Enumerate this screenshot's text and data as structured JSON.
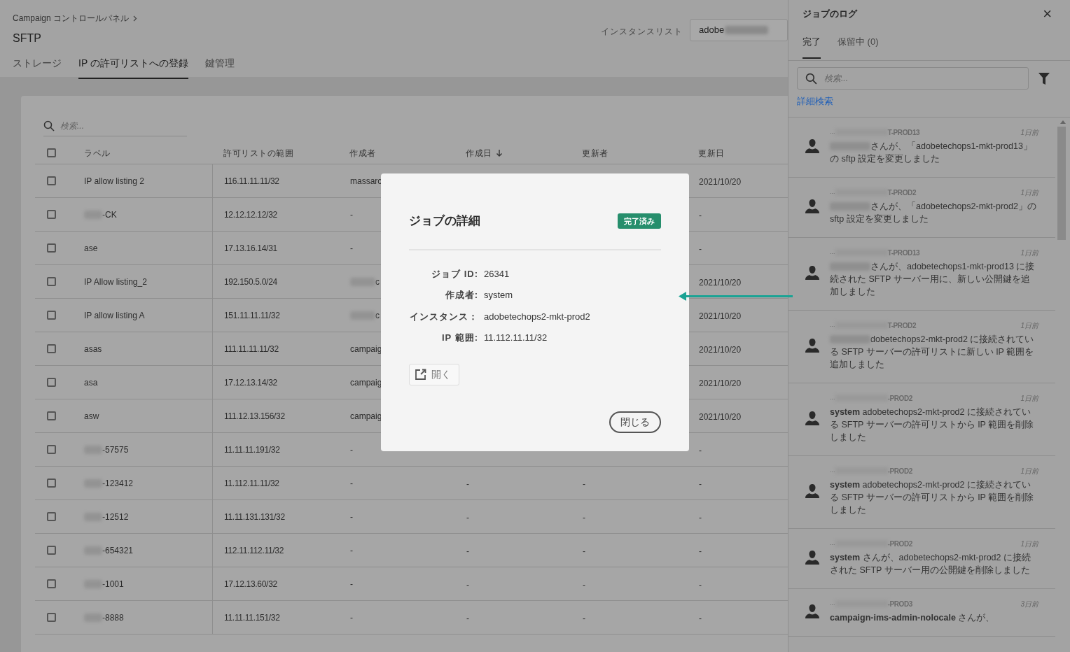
{
  "breadcrumb": {
    "text": "Campaign コントロールパネル"
  },
  "page_title": "SFTP",
  "tabs": [
    {
      "label": "ストレージ",
      "selected": false
    },
    {
      "label": "IP の許可リストへの登録",
      "selected": true
    },
    {
      "label": "鍵管理",
      "selected": false
    }
  ],
  "instance_list": {
    "label": "インスタンスリスト",
    "value": "adobe",
    "redacted": true
  },
  "table": {
    "search_placeholder": "検索...",
    "select_all_checked": false,
    "columns": [
      {
        "label": "ラベル"
      },
      {
        "label": "許可リストの範囲"
      },
      {
        "label": "作成者"
      },
      {
        "label": "作成日",
        "sorted": true
      },
      {
        "label": "更新者"
      },
      {
        "label": "更新日"
      }
    ],
    "rows": [
      {
        "checked": false,
        "label": "IP allow listing 2",
        "label_redacted": false,
        "range": "116.11.11.11/32",
        "creator": "massarc",
        "creator_redacted": false,
        "updated": "2021/10/20"
      },
      {
        "checked": false,
        "label": "-CK",
        "label_redacted": true,
        "range": "12.12.12.12/32",
        "creator": "-",
        "creator_redacted": false,
        "updated": "-"
      },
      {
        "checked": false,
        "label": "ase",
        "label_redacted": false,
        "range": "17.13.16.14/31",
        "creator": "-",
        "creator_redacted": false,
        "updated": "-"
      },
      {
        "checked": false,
        "label": "IP Allow listing_2",
        "label_redacted": false,
        "range": "192.150.5.0/24",
        "creator": "c",
        "creator_redacted": true,
        "updated": "2021/10/20"
      },
      {
        "checked": false,
        "label": "IP allow listing A",
        "label_redacted": false,
        "range": "151.11.11.11/32",
        "creator": "c",
        "creator_redacted": true,
        "updated": "2021/10/20"
      },
      {
        "checked": false,
        "label": "asas",
        "label_redacted": false,
        "range": "111.11.11.11/32",
        "creator": "campaig",
        "creator_redacted": false,
        "updated": "2021/10/20"
      },
      {
        "checked": false,
        "label": "asa",
        "label_redacted": false,
        "range": "17.12.13.14/32",
        "creator": "campaig",
        "creator_redacted": false,
        "updated": "2021/10/20"
      },
      {
        "checked": false,
        "label": "asw",
        "label_redacted": false,
        "range": "111.12.13.156/32",
        "creator": "campaig",
        "creator_redacted": false,
        "updated": "2021/10/20"
      },
      {
        "checked": false,
        "label": "-57575",
        "label_redacted": true,
        "range": "11.11.11.191/32",
        "creator": "-",
        "creator_redacted": false,
        "updated": "-"
      },
      {
        "checked": false,
        "label": "-123412",
        "label_redacted": true,
        "range": "11.112.11.11/32",
        "creator": "-",
        "creator_redacted": false,
        "created": "-",
        "updater": "-",
        "updated": "-"
      },
      {
        "checked": false,
        "label": "-12512",
        "label_redacted": true,
        "range": "11.11.131.131/32",
        "creator": "-",
        "creator_redacted": false,
        "created": "-",
        "updater": "-",
        "updated": "-"
      },
      {
        "checked": false,
        "label": "-654321",
        "label_redacted": true,
        "range": "112.11.112.11/32",
        "creator": "-",
        "creator_redacted": false,
        "created": "-",
        "updater": "-",
        "updated": "-"
      },
      {
        "checked": false,
        "label": "-1001",
        "label_redacted": true,
        "range": "17.12.13.60/32",
        "creator": "-",
        "creator_redacted": false,
        "created": "-",
        "updater": "-",
        "updated": "-"
      },
      {
        "checked": false,
        "label": "-8888",
        "label_redacted": true,
        "range": "11.11.11.151/32",
        "creator": "-",
        "creator_redacted": false,
        "created": "-",
        "updater": "-",
        "updated": "-"
      }
    ]
  },
  "job_log": {
    "title": "ジョブのログ",
    "close": "×",
    "tabs": [
      {
        "label": "完了",
        "selected": true
      },
      {
        "label": "保留中 (0)",
        "selected": false
      }
    ],
    "search_placeholder": "検索...",
    "advanced_search": "詳細検索",
    "items": [
      {
        "prefix": "...",
        "source": "T-PROD13",
        "time": "1日前",
        "user_redacted": true,
        "message": "さんが、「adobetechops1-mkt-prod13」の sftp 設定を変更しました"
      },
      {
        "prefix": "...",
        "source": "T-PROD2",
        "time": "1日前",
        "user_redacted": true,
        "message": "さんが、「adobetechops2-mkt-prod2」の sftp 設定を変更しました"
      },
      {
        "prefix": "...",
        "source": "T-PROD13",
        "time": "1日前",
        "user_redacted": true,
        "message": "さんが、adobetechops1-mkt-prod13 に接続された SFTP サーバー用に、新しい公開鍵を追加しました"
      },
      {
        "prefix": "...",
        "source": "T-PROD2",
        "time": "1日前",
        "user_redacted": true,
        "message": "dobetechops2-mkt-prod2 に接続されている SFTP サーバーの許可リストに新しい IP 範囲を追加しました"
      },
      {
        "prefix": "...",
        "source": "-PROD2",
        "time": "1日前",
        "user_redacted": false,
        "message": "**system** adobetechops2-mkt-prod2 に接続されている SFTP サーバーの許可リストから IP 範囲を削除しました"
      },
      {
        "prefix": "...",
        "source": "-PROD2",
        "time": "1日前",
        "user_redacted": false,
        "message": "**system** adobetechops2-mkt-prod2 に接続されている SFTP サーバーの許可リストから IP 範囲を削除しました"
      },
      {
        "prefix": "...",
        "source": "-PROD2",
        "time": "1日前",
        "user_redacted": false,
        "message": "**system** さんが、adobetechops2-mkt-prod2 に接続された SFTP サーバー用の公開鍵を削除しました"
      },
      {
        "prefix": "...",
        "source": "-PROD3",
        "time": "3日前",
        "user_redacted": false,
        "message": "**campaign-ims-admin-nolocale** さんが、"
      }
    ]
  },
  "modal": {
    "title": "ジョブの詳細",
    "status": "完了済み",
    "fields": [
      {
        "label": "ジョブ ID:",
        "value": "26341"
      },
      {
        "label": "作成者:",
        "value": "system"
      },
      {
        "label": "インスタンス：",
        "value": "adobetechops2-mkt-prod2"
      },
      {
        "label": "IP 範囲:",
        "value": "11.112.11.11/32"
      }
    ],
    "open_button": "開く",
    "close_button": "閉じる"
  }
}
